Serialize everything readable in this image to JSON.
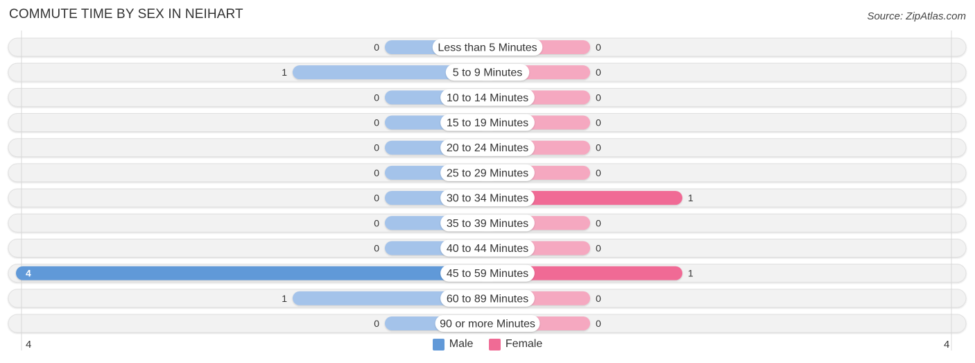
{
  "title": "COMMUTE TIME BY SEX IN NEIHART",
  "source": "Source: ZipAtlas.com",
  "colors": {
    "male_strong": "#6199d8",
    "male_light": "#a4c3ea",
    "female_strong": "#f06b95",
    "female_light": "#f5a8c0",
    "row_bg": "#f2f2f2"
  },
  "chart_data": {
    "type": "bar",
    "orientation": "horizontal-diverging",
    "title": "COMMUTE TIME BY SEX IN NEIHART",
    "categories": [
      "Less than 5 Minutes",
      "5 to 9 Minutes",
      "10 to 14 Minutes",
      "15 to 19 Minutes",
      "20 to 24 Minutes",
      "25 to 29 Minutes",
      "30 to 34 Minutes",
      "35 to 39 Minutes",
      "40 to 44 Minutes",
      "45 to 59 Minutes",
      "60 to 89 Minutes",
      "90 or more Minutes"
    ],
    "series": [
      {
        "name": "Male",
        "values": [
          0,
          1,
          0,
          0,
          0,
          0,
          0,
          0,
          0,
          4,
          1,
          0
        ]
      },
      {
        "name": "Female",
        "values": [
          0,
          0,
          0,
          0,
          0,
          0,
          1,
          0,
          0,
          1,
          0,
          0
        ]
      }
    ],
    "axis_range": [
      4,
      4
    ],
    "axis_labels": {
      "left": "4",
      "right": "4"
    },
    "legend": {
      "position": "bottom-center",
      "entries": [
        "Male",
        "Female"
      ]
    }
  }
}
